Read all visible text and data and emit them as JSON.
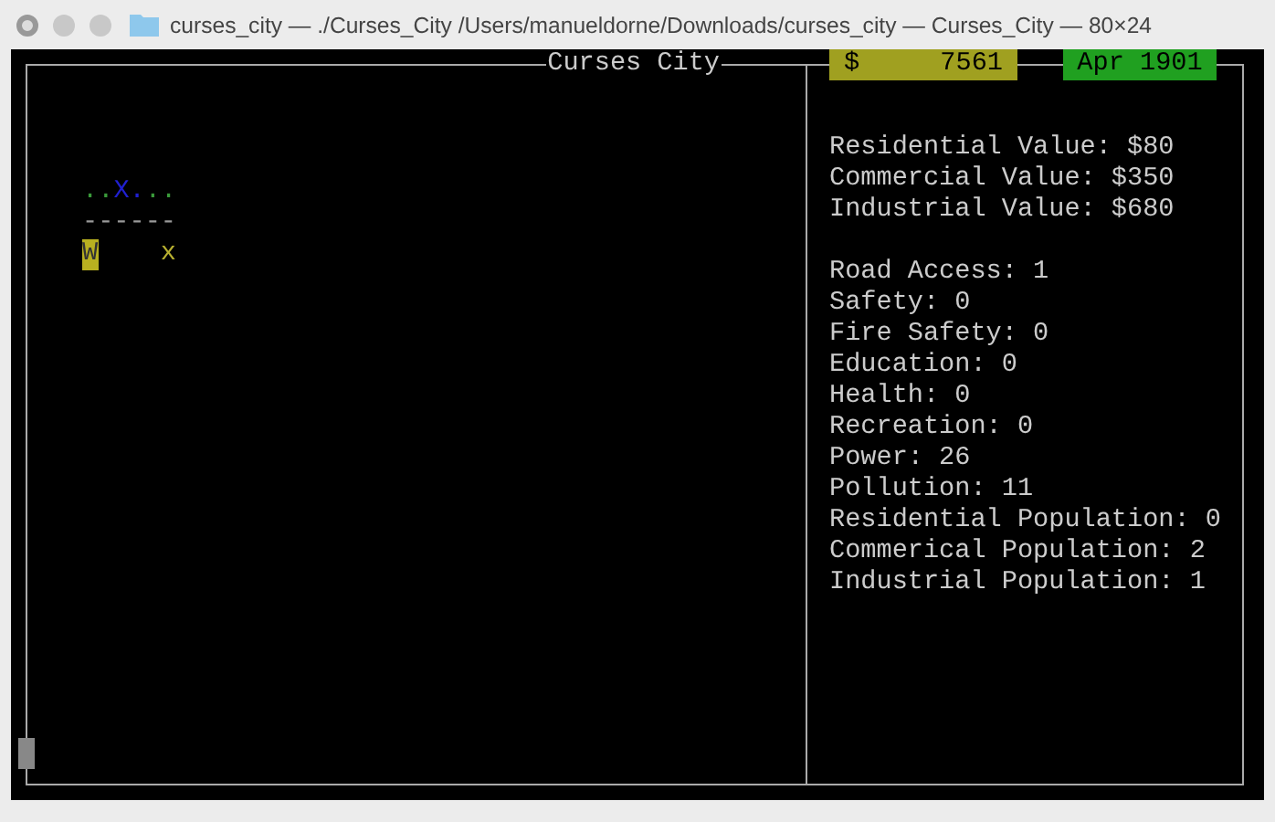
{
  "window": {
    "title": "curses_city — ./Curses_City /Users/manueldorne/Downloads/curses_city — Curses_City — 80×24"
  },
  "header": {
    "title": "Curses City",
    "money_symbol": "$",
    "money": "7561",
    "date": "Apr 1901"
  },
  "map": {
    "rows": [
      {
        "cells": [
          {
            "char": ".",
            "color": "#3a9a3a"
          },
          {
            "char": ".",
            "color": "#3a9a3a"
          },
          {
            "char": "X",
            "color": "#2020d0"
          },
          {
            "char": ".",
            "color": "#2020d0"
          },
          {
            "char": ".",
            "color": "#3a9a3a"
          },
          {
            "char": ".",
            "color": "#3a9a3a"
          }
        ]
      },
      {
        "cells": [
          {
            "char": "------",
            "color": "#9a9a9a"
          }
        ]
      },
      {
        "cells": [
          {
            "char": "W",
            "color": "#b8b020",
            "highlighted": true
          },
          {},
          {},
          {},
          {},
          {
            "char": "x",
            "color": "#b8b030",
            "highlighted": false
          }
        ]
      }
    ]
  },
  "stats": [
    [
      "Residential Value: $80",
      "Commercial Value: $350",
      "Industrial Value: $680"
    ],
    [
      "Road Access: 1",
      "Safety: 0",
      "Fire Safety: 0",
      "Education: 0",
      "Health: 0",
      "Recreation: 0",
      "Power: 26",
      "Pollution: 11",
      "Residential Population: 0",
      "Commerical Population: 2",
      "Industrial Population: 1"
    ]
  ]
}
